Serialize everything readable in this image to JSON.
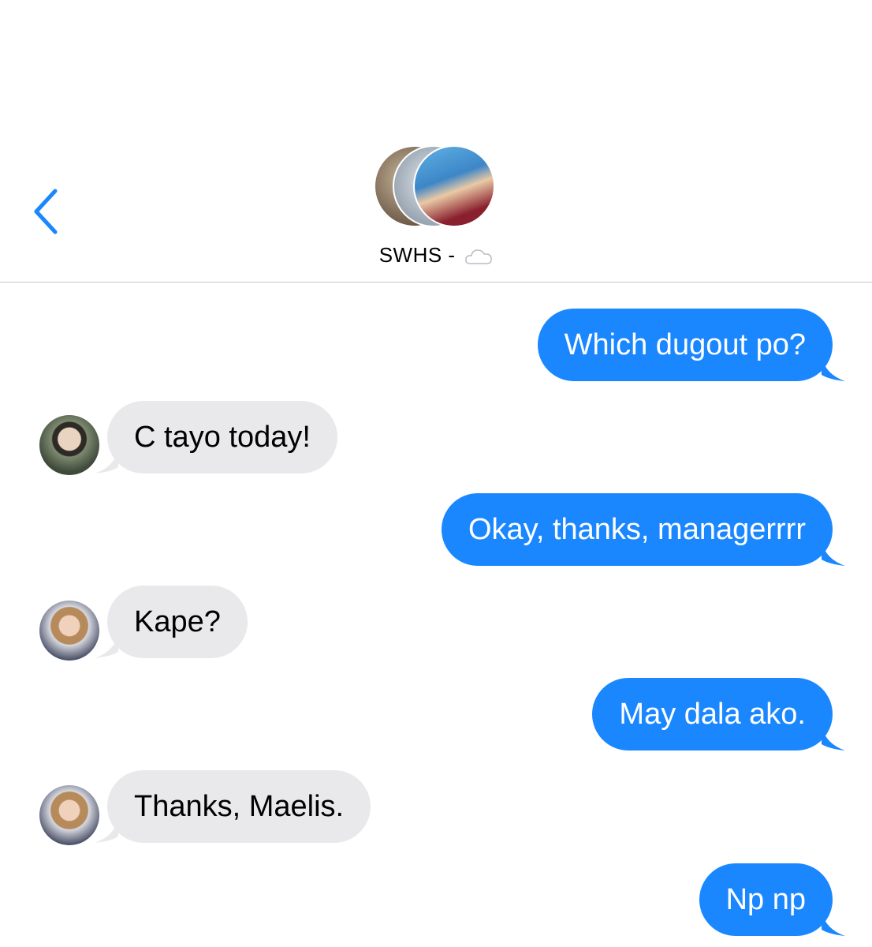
{
  "header": {
    "group_name": "SWHS -",
    "title_emoji_icon": "cloud-icon",
    "back_icon": "chevron-left-icon",
    "accent_color": "#1a87ff"
  },
  "messages": [
    {
      "direction": "outgoing",
      "text": "Which dugout po?"
    },
    {
      "direction": "incoming",
      "text": "C tayo today!"
    },
    {
      "direction": "outgoing",
      "text": "Okay, thanks, managerrrr"
    },
    {
      "direction": "incoming",
      "text": "Kape?"
    },
    {
      "direction": "outgoing",
      "text": "May dala ako."
    },
    {
      "direction": "incoming",
      "text": "Thanks, Maelis."
    },
    {
      "direction": "outgoing",
      "text": "Np np"
    }
  ],
  "colors": {
    "outgoing_bubble": "#1a87ff",
    "incoming_bubble": "#e9e9eb"
  }
}
